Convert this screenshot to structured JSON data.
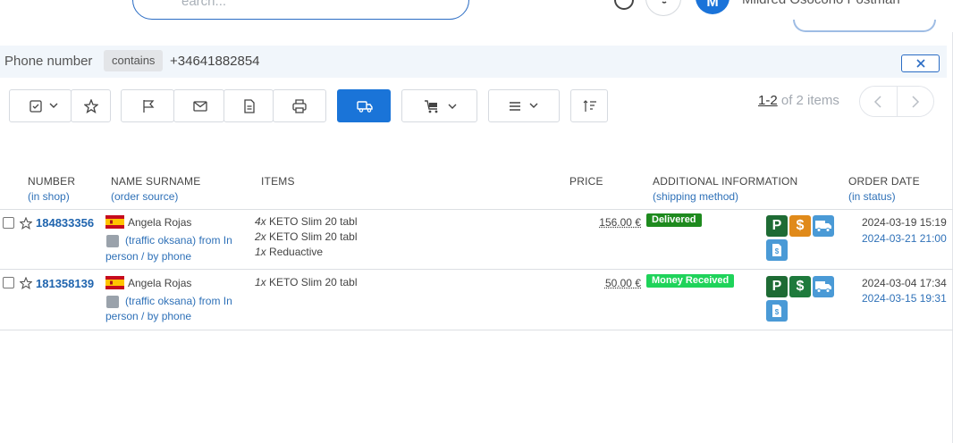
{
  "header": {
    "search_placeholder": "earch...",
    "user_name": "Mildred Osocorio Postman",
    "avatar_initial": "M"
  },
  "filter": {
    "field": "Phone number",
    "operator": "contains",
    "value": "+34641882854"
  },
  "toolbar": {
    "buttons": [
      "select-icon",
      "star-icon",
      "flag-icon",
      "mail-icon",
      "document-icon",
      "print-icon",
      "truck-icon",
      "cart-icon",
      "menu-icon",
      "sort-icon"
    ]
  },
  "pager": {
    "range": "1-2",
    "of_text": " of 2 items"
  },
  "table": {
    "columns": [
      {
        "label": "NUMBER",
        "sub": "(in shop)"
      },
      {
        "label": "NAME SURNAME",
        "sub": "(order source)"
      },
      {
        "label": "ITEMS",
        "sub": ""
      },
      {
        "label": "PRICE",
        "sub": ""
      },
      {
        "label": "ADDITIONAL INFORMATION",
        "sub": "(shipping method)"
      },
      {
        "label": "ORDER DATE",
        "sub": "(in status)"
      }
    ],
    "rows": [
      {
        "number": "184833356",
        "name": "Angela Rojas",
        "source_line1": "(traffic oksana) from In",
        "source_line2": "person / by phone",
        "items": [
          {
            "qty": "4x",
            "name": " KETO Slim 20 tabl"
          },
          {
            "qty": "2x",
            "name": " KETO Slim 20 tabl"
          },
          {
            "qty": "1x",
            "name": " Reduactive"
          }
        ],
        "price": "156.00 €",
        "status": "Delivered",
        "status_color": "#1e8a1e",
        "payment_icon_color": "#e08a1a",
        "date_order": "2024-03-19 15:19",
        "date_status": "2024-03-21 21:00"
      },
      {
        "number": "181358139",
        "name": "Angela Rojas",
        "source_line1": "(traffic oksana) from In",
        "source_line2": "person / by phone",
        "items": [
          {
            "qty": "1x",
            "name": " KETO Slim 20 tabl"
          }
        ],
        "price": "50.00 €",
        "status": "Money Received",
        "status_color": "#1fd35a",
        "payment_icon_color": "#1e7a3c",
        "date_order": "2024-03-04 17:34",
        "date_status": "2024-03-15 19:31"
      }
    ],
    "icon_labels": {
      "parking": "P",
      "payment": "$"
    }
  },
  "colors": {
    "accent": "#1a74d8",
    "parking_green": "#1e6b34",
    "shipping_blue": "#4a9ad6"
  }
}
